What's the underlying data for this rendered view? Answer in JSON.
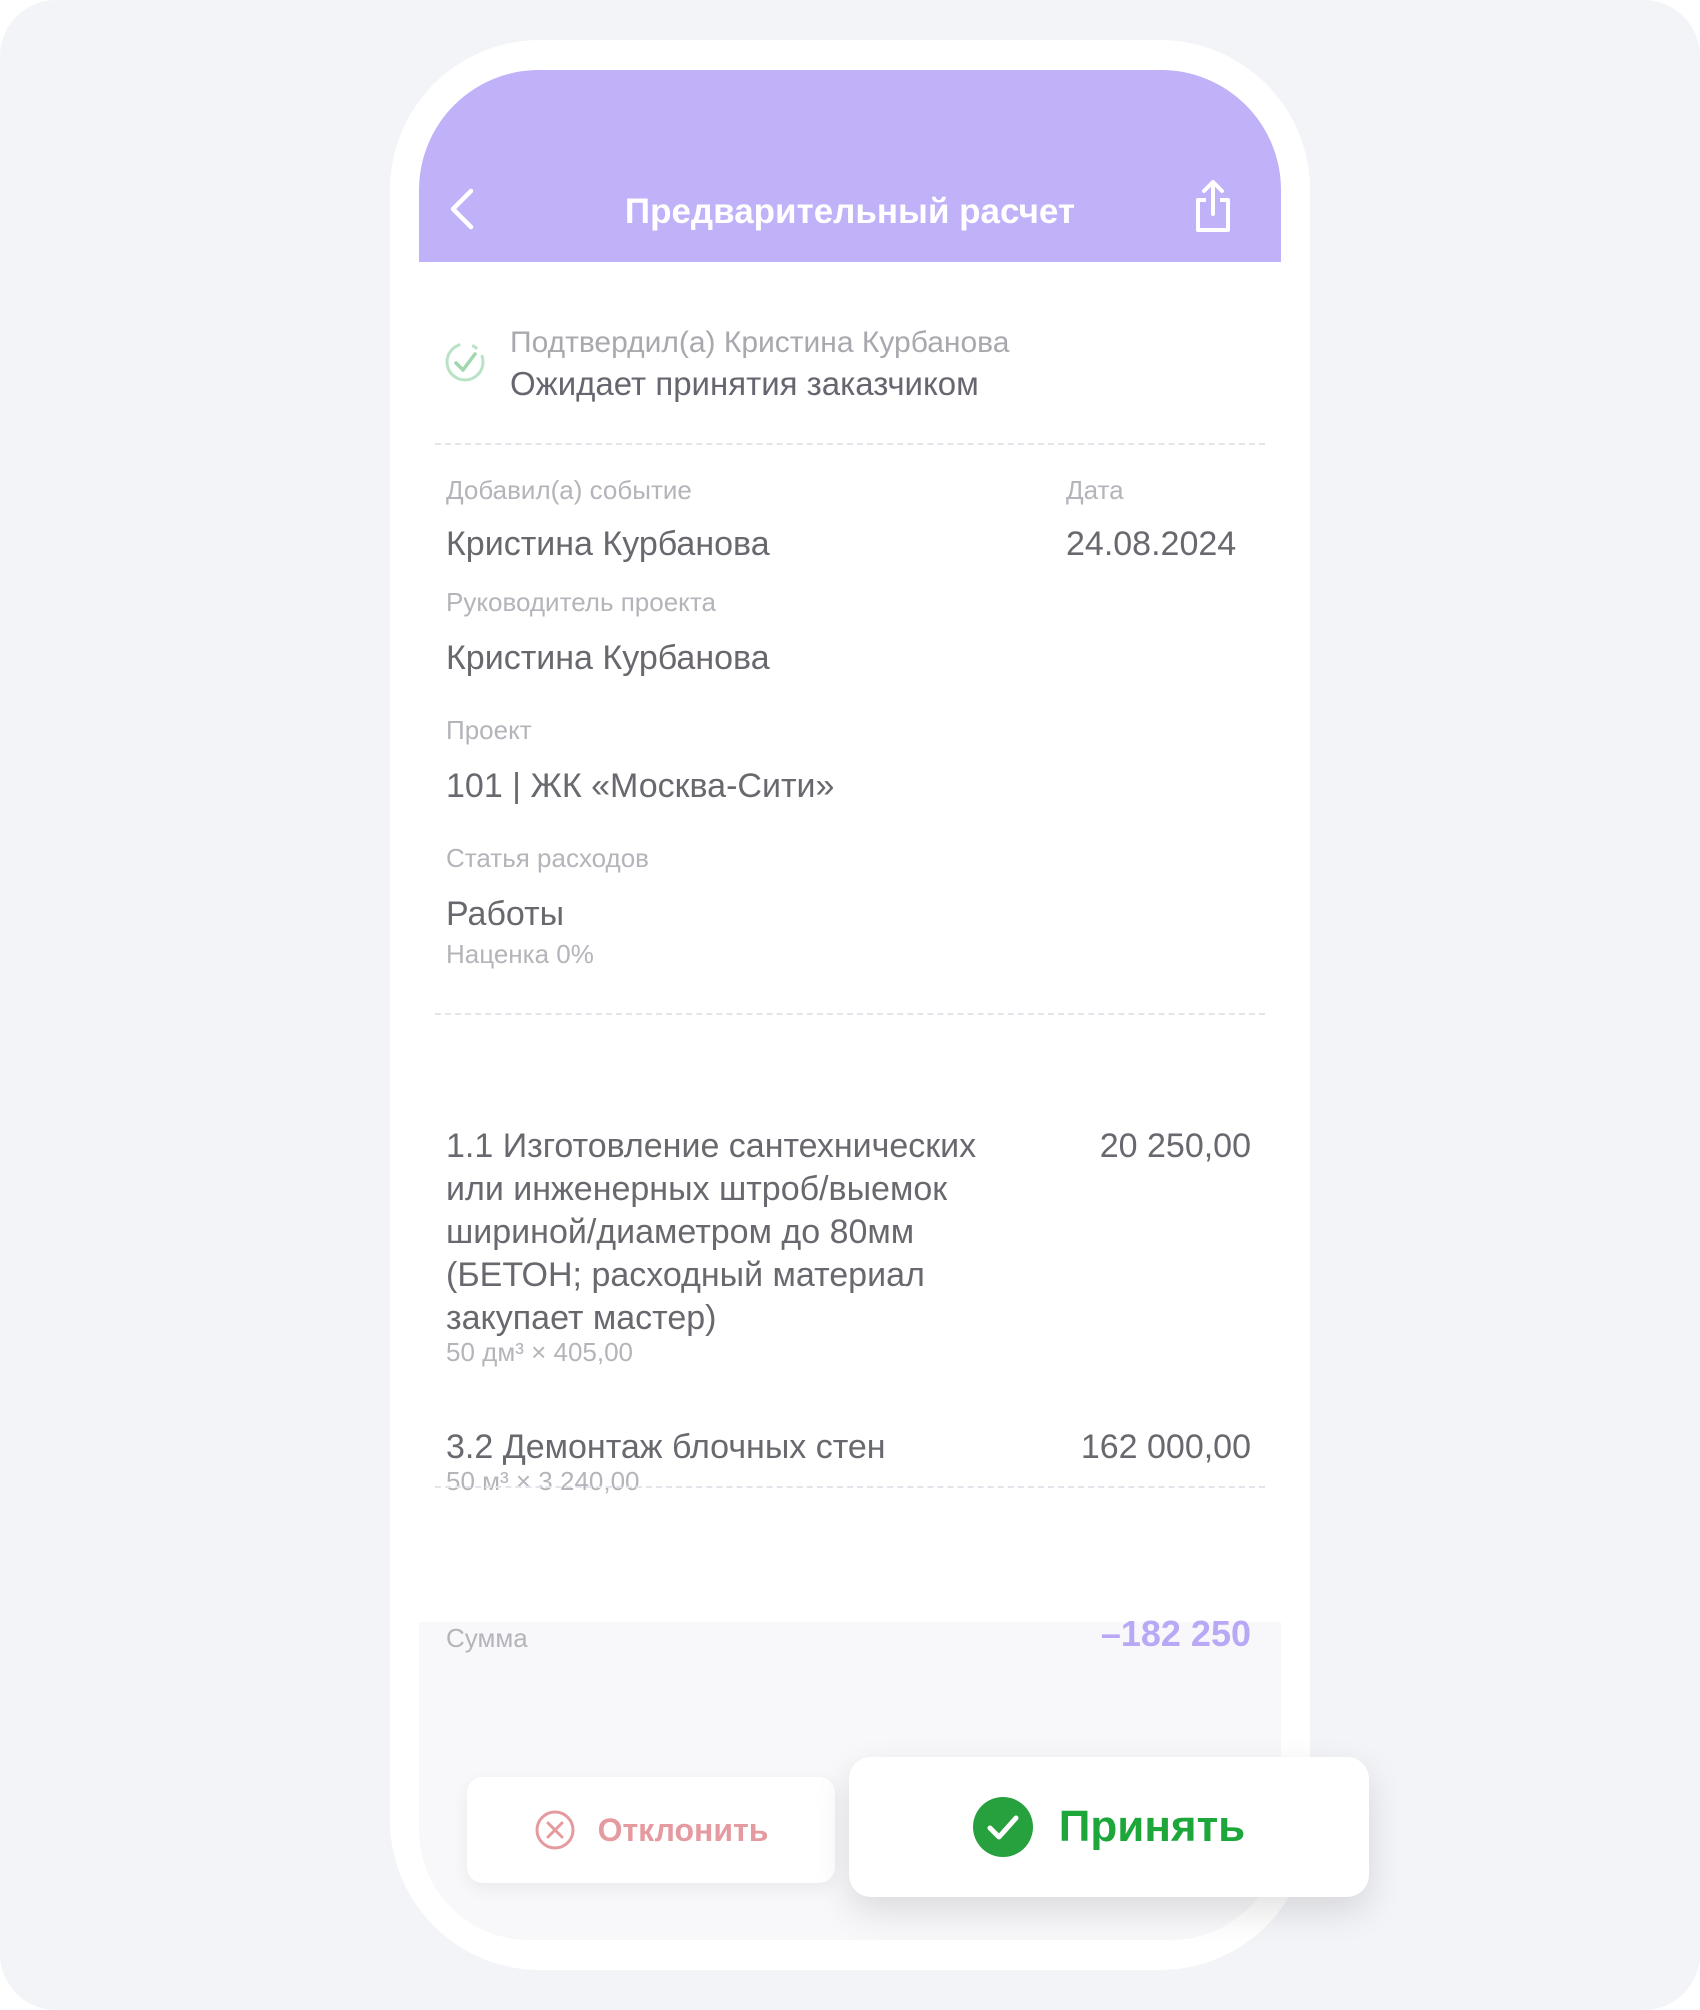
{
  "header": {
    "title": "Предварительный расчет",
    "back_icon": "chevron-left-icon",
    "share_icon": "share-icon"
  },
  "status": {
    "confirmed_by": "Подтвердил(а) Кристина Курбанова",
    "text": "Ожидает принятия заказчиком",
    "icon": "check-circle-icon"
  },
  "details": {
    "added_by_label": "Добавил(а) событие",
    "added_by_value": "Кристина Курбанова",
    "date_label": "Дата",
    "date_value": "24.08.2024",
    "manager_label": "Руководитель проекта",
    "manager_value": "Кристина Курбанова",
    "project_label": "Проект",
    "project_value": "101 | ЖК «Москва-Сити»",
    "expense_label": "Статья расходов",
    "expense_value": "Работы",
    "markup": "Наценка 0%"
  },
  "items": [
    {
      "name": "1.1 Изготовление сантехнических или инженерных штроб/выемок шириной/диаметром до 80мм (БЕТОН; расходный материал закупает мастер)",
      "qty": "50 дм³ × 405,00",
      "price": "20 250,00"
    },
    {
      "name": "3.2 Демонтаж блочных стен",
      "qty": "50 м³ × 3 240,00",
      "price": "162 000,00"
    }
  ],
  "total": {
    "label": "Сумма",
    "value": "–182 250"
  },
  "actions": {
    "reject_label": "Отклонить",
    "accept_label": "Принять"
  },
  "colors": {
    "header_bg": "#c0b1f8",
    "accent": "#b8a8f5",
    "accept_green": "#1da63a",
    "reject_red": "#e59a9f"
  }
}
